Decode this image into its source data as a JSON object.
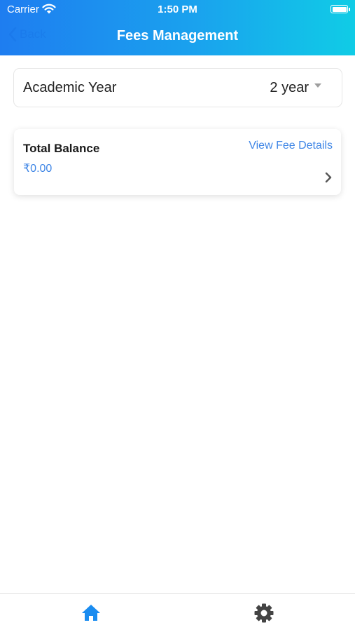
{
  "status_bar": {
    "carrier": "Carrier",
    "time": "1:50 PM"
  },
  "nav": {
    "back_label": "Back",
    "title": "Fees Management"
  },
  "academic_year": {
    "label": "Academic Year",
    "value": "2 year"
  },
  "balance_card": {
    "title": "Total Balance",
    "amount": "₹0.00",
    "link_label": "View Fee Details"
  },
  "tab_bar": {
    "tabs": [
      {
        "icon": "home-icon",
        "active": true
      },
      {
        "icon": "gear-icon",
        "active": false
      }
    ]
  },
  "colors": {
    "header_start": "#1e7df0",
    "header_end": "#10cce6",
    "accent": "#3f86e6",
    "tab_active": "#1a8cf0",
    "tab_inactive": "#444444"
  }
}
